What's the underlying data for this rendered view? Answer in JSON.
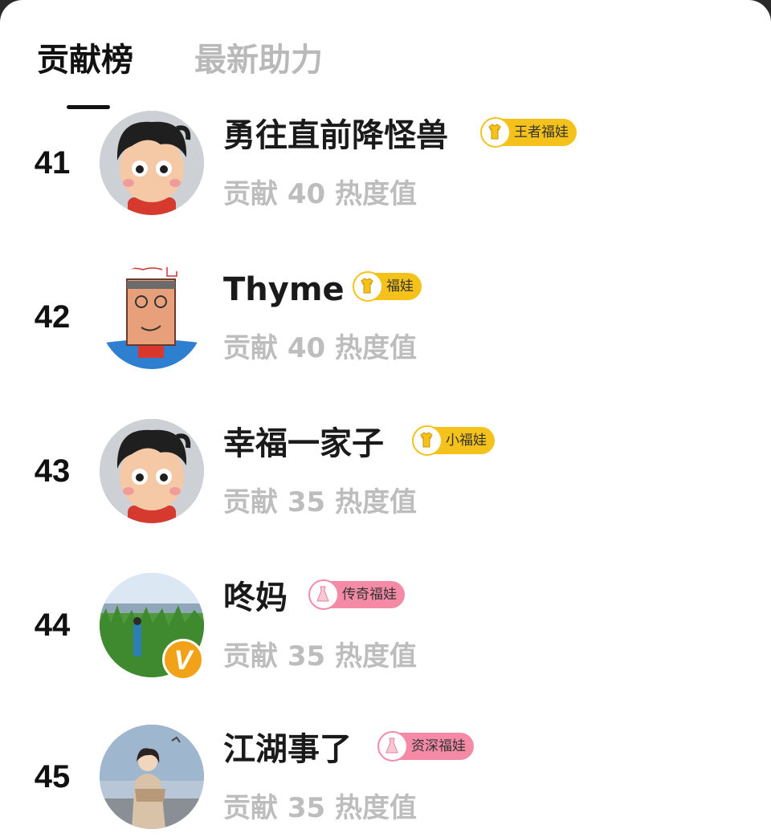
{
  "tabs": {
    "active": "贡献榜",
    "inactive": "最新助力"
  },
  "rows": [
    {
      "rank": "41",
      "name": "勇往直前降怪兽",
      "badge": "王者福娃",
      "score": "贡献 40 热度值",
      "avatar": "default-cartoon-avatar",
      "badge_color": "#f4c21a"
    },
    {
      "rank": "42",
      "name": "Thyme",
      "badge": "福娃",
      "score": "贡献 40 热度值",
      "avatar": "child-drawing-avatar",
      "badge_color": "#f4c21a"
    },
    {
      "rank": "43",
      "name": "幸福一家子",
      "badge": "小福娃",
      "score": "贡献 35 热度值",
      "avatar": "default-cartoon-avatar",
      "badge_color": "#f4c21a"
    },
    {
      "rank": "44",
      "name": "咚妈",
      "badge": "传奇福娃",
      "score": "贡献 35 热度值",
      "avatar": "grass-field-photo-avatar",
      "verified": "V",
      "badge_color": "#f48aa6"
    },
    {
      "rank": "45",
      "name": "江湖事了",
      "badge": "资深福娃",
      "score": "贡献 35 热度值",
      "avatar": "woman-photo-avatar",
      "badge_color": "#f48aa6"
    }
  ]
}
